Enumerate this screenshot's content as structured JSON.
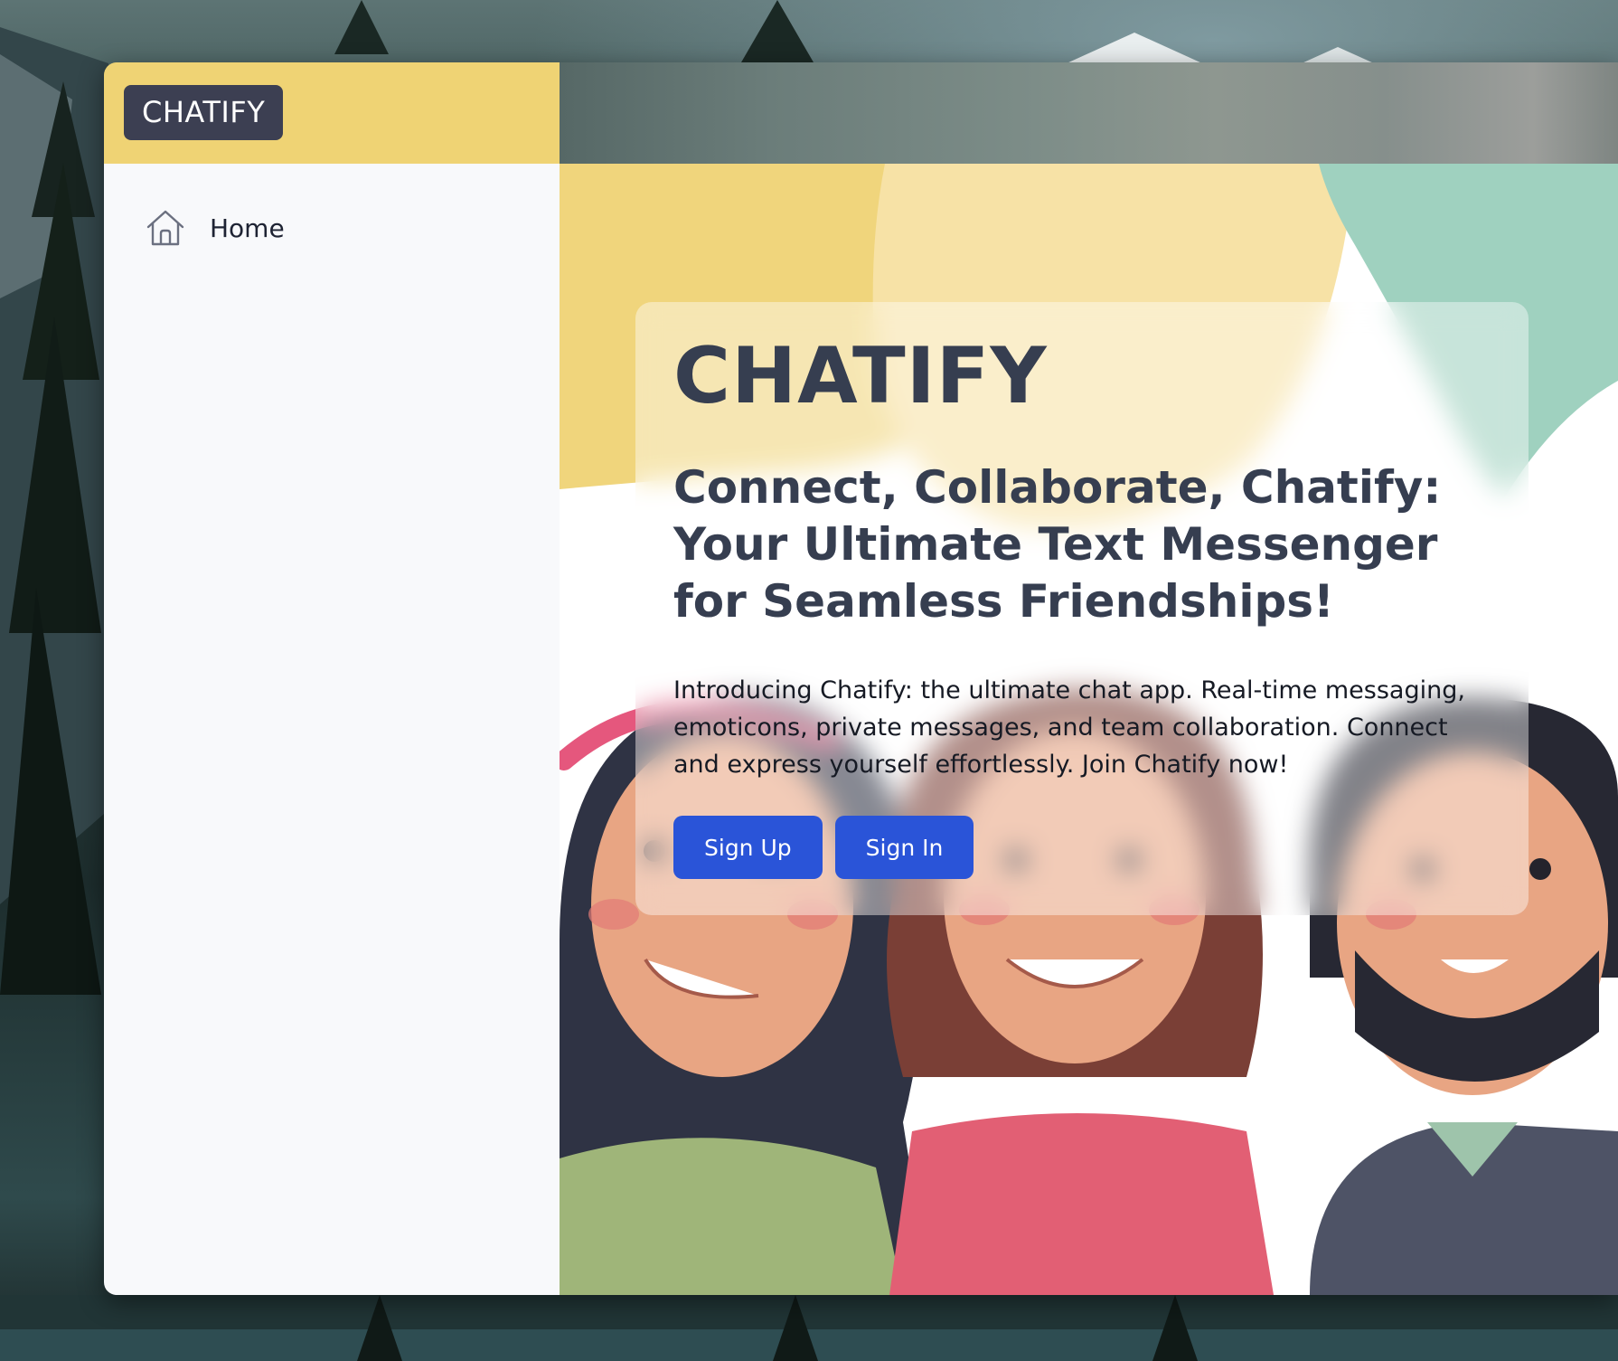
{
  "brand": {
    "logo_text": "CHATIFY"
  },
  "sidebar": {
    "items": [
      {
        "label": "Home",
        "icon": "home-icon"
      }
    ]
  },
  "hero": {
    "title": "CHATIFY",
    "subtitle": "Connect, Collaborate, Chatify: Your Ultimate Text Messenger for Seamless Friendships!",
    "description": "Introducing Chatify: the ultimate chat app. Real-time messaging, emoticons, private messages, and team collaboration. Connect and express yourself effortlessly. Join Chatify now!",
    "buttons": {
      "sign_up": "Sign Up",
      "sign_in": "Sign In"
    }
  },
  "colors": {
    "brand_yellow": "#efd374",
    "brand_badge": "#3c3f52",
    "sidebar_bg": "#f8f9fb",
    "text_dark": "#363e50",
    "button_blue": "#2a54d8",
    "accent_mint": "#9ccfbd"
  }
}
